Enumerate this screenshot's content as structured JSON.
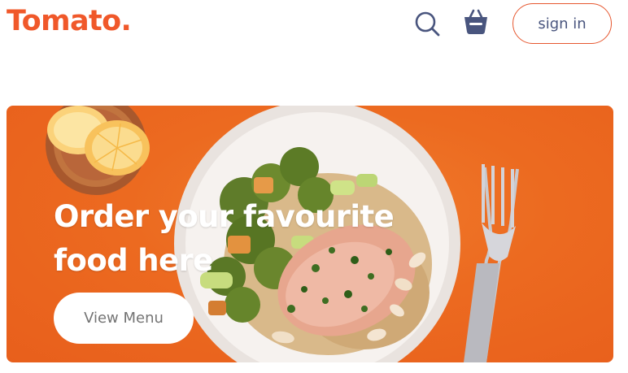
{
  "header": {
    "logo": "Tomato.",
    "search_icon": "search-icon",
    "basket_icon": "basket-icon",
    "signin_label": "sign in"
  },
  "hero": {
    "title": "Order your favourite food here",
    "button_label": "View Menu"
  },
  "colors": {
    "brand": "#f0582a",
    "nav_icon": "#49557e",
    "hero_bg": "#ec6a20"
  }
}
